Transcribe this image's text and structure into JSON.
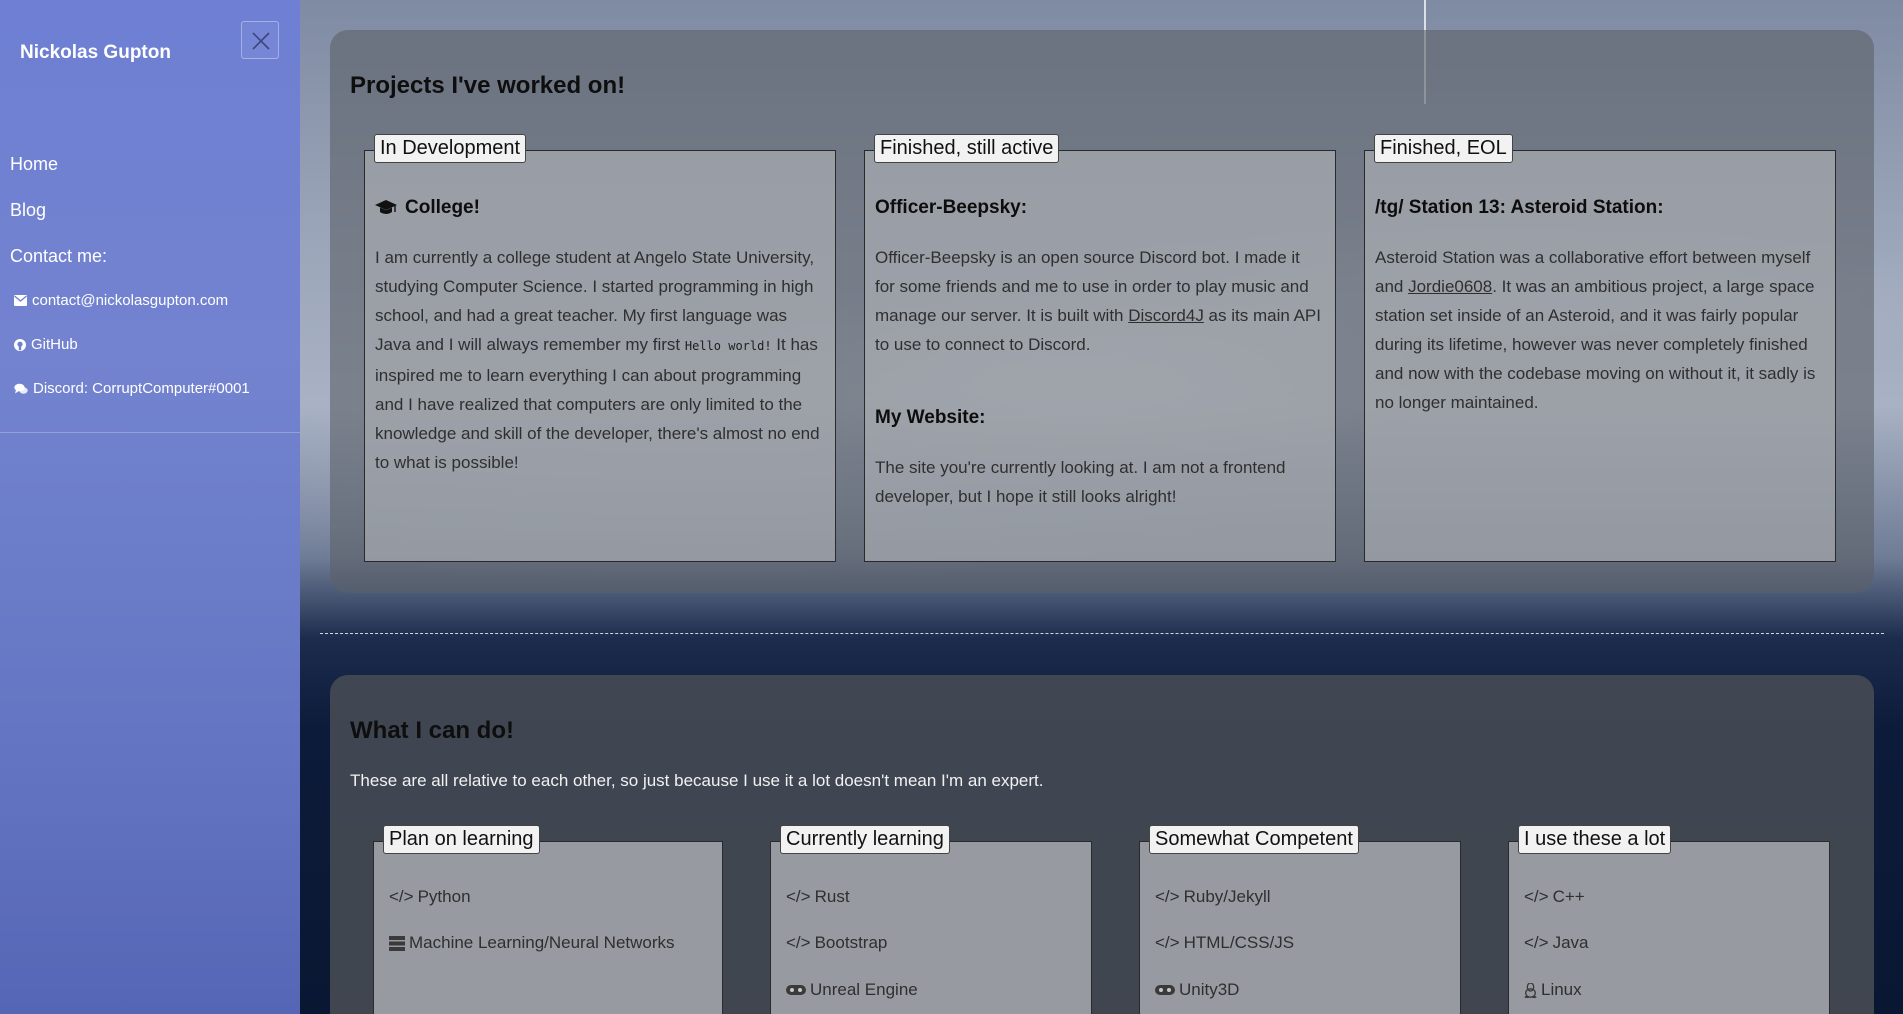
{
  "sidebar": {
    "brand": "Nickolas Gupton",
    "nav": {
      "home": "Home",
      "blog": "Blog",
      "contact_heading": "Contact me:"
    },
    "contacts": {
      "email": "contact@nickolasgupton.com",
      "github": "GitHub",
      "discord": "Discord: CorruptComputer#0001"
    },
    "icons": {
      "close": "close-icon",
      "email": "envelope-icon",
      "github": "github-icon",
      "discord": "chat-icon"
    }
  },
  "projects": {
    "title": "Projects I've worked on!",
    "in_development": {
      "legend": "In Development",
      "heading": "College!",
      "text_before": "I am currently a college student at Angelo State University, studying Computer Science. I started programming in high school, and had a great teacher. My first language was Java and I will always remember my first ",
      "code": "Hello world!",
      "text_after": " It has inspired me to learn everything I can about programming and I have realized that computers are only limited to the knowledge and skill of the developer, there's almost no end to what is possible!"
    },
    "finished_active": {
      "legend": "Finished, still active",
      "beepsky_heading": "Officer-Beepsky:",
      "beepsky_text_before": "Officer-Beepsky is an open source Discord bot. I made it for some friends and me to use in order to play music and manage our server. It is built with ",
      "beepsky_link": "Discord4J",
      "beepsky_text_after": " as its main API to use to connect to Discord.",
      "website_heading": "My Website:",
      "website_text": "The site you're currently looking at. I am not a frontend developer, but I hope it still looks alright!"
    },
    "finished_eol": {
      "legend": "Finished, EOL",
      "heading": "/tg/ Station 13: Asteroid Station:",
      "text_before": "Asteroid Station was a collaborative effort between myself and ",
      "link": "Jordie0608",
      "text_after": ". It was an ambitious project, a large space station set inside of an Asteroid, and it was fairly popular during its lifetime, however was never completely finished and now with the codebase moving on without it, it sadly is no longer maintained."
    }
  },
  "skills": {
    "title": "What I can do!",
    "subtitle": "These are all relative to each other, so just because I use it a lot doesn't mean I'm an expert.",
    "categories": [
      {
        "legend": "Plan on learning",
        "items": [
          {
            "icon": "code-icon",
            "label": "Python"
          },
          {
            "icon": "server-icon",
            "label": "Machine Learning/Neural Networks"
          }
        ]
      },
      {
        "legend": "Currently learning",
        "items": [
          {
            "icon": "code-icon",
            "label": "Rust"
          },
          {
            "icon": "code-icon",
            "label": "Bootstrap"
          },
          {
            "icon": "gamepad-icon",
            "label": "Unreal Engine"
          }
        ]
      },
      {
        "legend": "Somewhat Competent",
        "items": [
          {
            "icon": "code-icon",
            "label": "Ruby/Jekyll"
          },
          {
            "icon": "code-icon",
            "label": "HTML/CSS/JS"
          },
          {
            "icon": "gamepad-icon",
            "label": "Unity3D"
          }
        ]
      },
      {
        "legend": "I use these a lot",
        "items": [
          {
            "icon": "code-icon",
            "label": "C++"
          },
          {
            "icon": "code-icon",
            "label": "Java"
          },
          {
            "icon": "linux-icon",
            "label": "Linux"
          }
        ]
      }
    ]
  }
}
